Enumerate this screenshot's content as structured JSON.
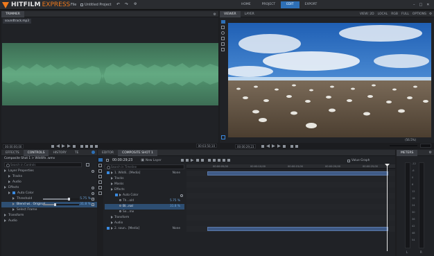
{
  "app": {
    "logo_main": "HITFILM",
    "logo_sub": "EXPRESS",
    "file_menu": "File",
    "project_name": "Untitled Project",
    "accent_color": "#f07a1c",
    "active_color": "#2d6fb6"
  },
  "nav_tabs": [
    {
      "label": "HOME",
      "active": false
    },
    {
      "label": "PROJECT",
      "active": false
    },
    {
      "label": "EDIT",
      "active": true
    },
    {
      "label": "EXPORT",
      "active": false
    }
  ],
  "trimmer": {
    "tab": "TRIMMER",
    "clip_name": "soundtrack.mp3",
    "time_start": "00:00:00;00",
    "time_end": "00:03:50;10"
  },
  "viewer": {
    "tabs": [
      "VIEWER",
      "LAYER"
    ],
    "view_label": "VIEW: 2D",
    "space_label": "LOCAL",
    "channel_label": "RGB",
    "quality_label": "FULL",
    "options_label": "OPTIONS",
    "time_current": "00:00:29;23",
    "zoom": "(56.5%)"
  },
  "controls": {
    "tabs": [
      "EFFECTS",
      "CONTROLS",
      "HISTORY",
      "TE"
    ],
    "breadcrumb": "Composite Shot 1 > Wildlife..wmv",
    "search_placeholder": "Search in Controls",
    "rows": [
      {
        "label": "Layer Properties",
        "indent": 0,
        "gear": true
      },
      {
        "label": "Tracks",
        "indent": 1,
        "gear": false
      },
      {
        "label": "Audio",
        "indent": 1,
        "gear": false
      },
      {
        "label": "Effects",
        "indent": 0,
        "gear": true
      },
      {
        "label": "Auto Color",
        "indent": 1,
        "gear": true
      },
      {
        "label": "Threshold",
        "indent": 2,
        "value": "5.75 %",
        "slider": 0.72,
        "highlight": false
      },
      {
        "label": "Blend wi.. Original",
        "indent": 2,
        "value": "31.8 %",
        "slider": 0.32,
        "highlight": true
      },
      {
        "label": "Select Frame",
        "indent": 2,
        "gear": false
      },
      {
        "label": "Transform",
        "indent": 0,
        "gear": false
      },
      {
        "label": "Audio",
        "indent": 0,
        "gear": false
      }
    ]
  },
  "editor": {
    "tabs": [
      "EDITOR",
      "COMPOSITE SHOT 1"
    ],
    "current_time": "00:00:29;23",
    "new_layer_label": "New Layer",
    "value_graph_label": "Value Graph",
    "search_placeholder": "Search in Timeline",
    "ruler_ticks": [
      "00:00:05;00",
      "00:00:10;00",
      "00:00:15;00",
      "00:00:20;00",
      "00:00:25;00"
    ],
    "layers": [
      {
        "label": "1. Wildli.. [Media]",
        "blend": "None",
        "indent": 0,
        "kind": "layer"
      },
      {
        "label": "Tracks",
        "indent": 1,
        "kind": "prop"
      },
      {
        "label": "Masks",
        "indent": 1,
        "kind": "prop"
      },
      {
        "label": "Effects",
        "indent": 1,
        "kind": "prop"
      },
      {
        "label": "Auto Color",
        "indent": 2,
        "kind": "effect"
      },
      {
        "label": "Th...old",
        "value": "5.75 %",
        "indent": 3,
        "kind": "param"
      },
      {
        "label": "Bl...nal",
        "value": "31.8 %",
        "indent": 3,
        "kind": "param",
        "highlight": true
      },
      {
        "label": "Se...me",
        "indent": 3,
        "kind": "param"
      },
      {
        "label": "Transform",
        "indent": 1,
        "kind": "prop"
      },
      {
        "label": "Audio",
        "indent": 1,
        "kind": "prop"
      },
      {
        "label": "2. soun.. [Media]",
        "blend": "None",
        "indent": 0,
        "kind": "layer"
      }
    ]
  },
  "meters": {
    "tab": "METERS",
    "scale": [
      "-12",
      "-6",
      "0",
      "6",
      "12",
      "18",
      "24",
      "30",
      "36",
      "42",
      "48",
      "54"
    ],
    "channel_labels": [
      "L",
      "R"
    ]
  }
}
